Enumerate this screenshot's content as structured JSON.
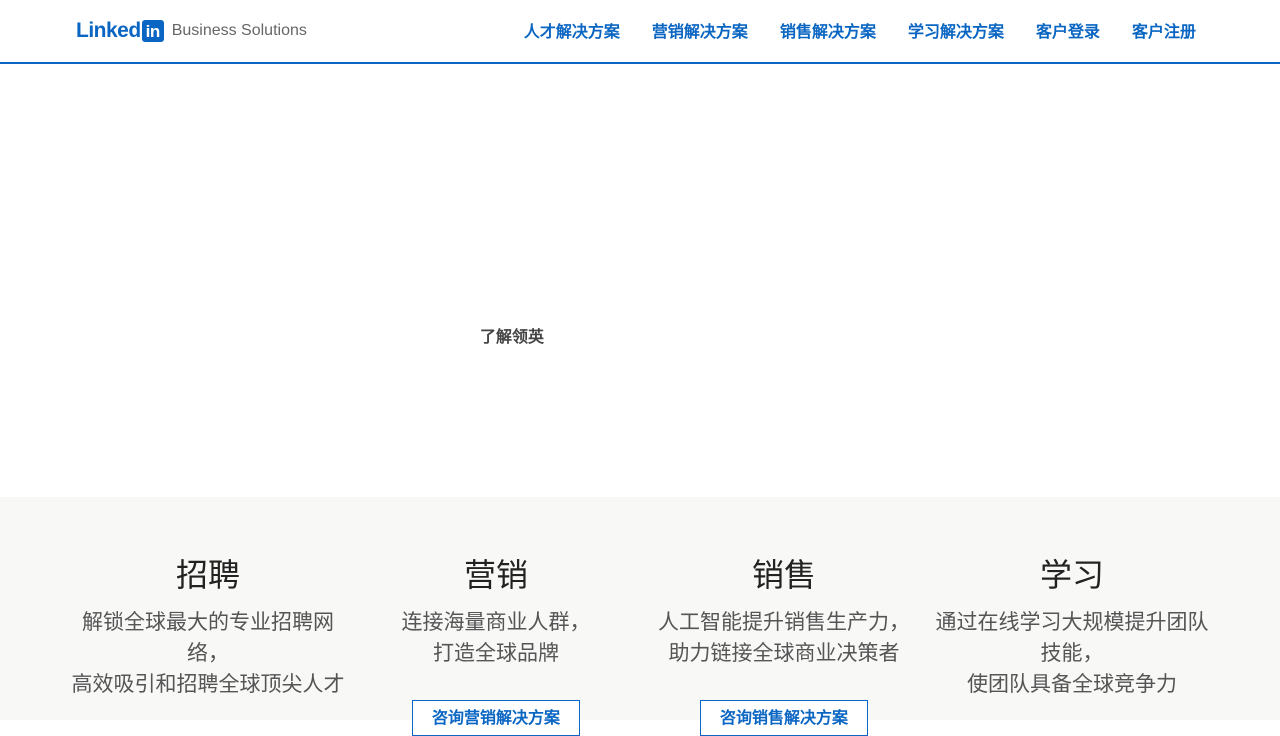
{
  "header": {
    "logo_linked": "Linked",
    "logo_in": "in",
    "logo_sub": "Business Solutions",
    "nav": [
      {
        "label": "人才解决方案"
      },
      {
        "label": "营销解决方案"
      },
      {
        "label": "销售解决方案"
      },
      {
        "label": "学习解决方案"
      },
      {
        "label": "客户登录"
      },
      {
        "label": "客户注册"
      }
    ]
  },
  "hero": {
    "link_label": "了解领英"
  },
  "solutions": [
    {
      "title": "招聘",
      "desc_line1": "解锁全球最大的专业招聘网",
      "desc_line2": "络，",
      "desc_line3": "高效吸引和招聘全球顶尖人才",
      "button": ""
    },
    {
      "title": "营销",
      "desc_line1": "连接海量商业人群，",
      "desc_line2": "打造全球品牌",
      "desc_line3": "",
      "button": "咨询营销解决方案"
    },
    {
      "title": "销售",
      "desc_line1": "人工智能提升销售生产力，",
      "desc_line2": "助力链接全球商业决策者",
      "desc_line3": "",
      "button": "咨询销售解决方案"
    },
    {
      "title": "学习",
      "desc_line1": "通过在线学习大规模提升团队",
      "desc_line2": "技能，",
      "desc_line3": "使团队具备全球竞争力",
      "button": ""
    }
  ],
  "colors": {
    "brand": "#0a66c2",
    "section_bg": "#f8f8f7"
  }
}
